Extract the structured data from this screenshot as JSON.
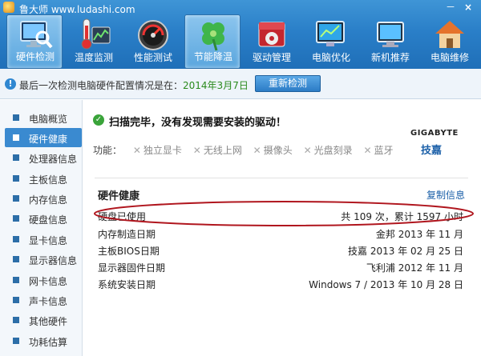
{
  "app": {
    "title": "鲁大师 www.ludashi.com",
    "minimize_label": "－",
    "close_label": "×"
  },
  "toolbar": {
    "items": [
      {
        "label": "硬件检测",
        "icon": "monitor-magnifier-icon",
        "active": true
      },
      {
        "label": "温度监测",
        "icon": "thermometer-icon",
        "active": false
      },
      {
        "label": "性能测试",
        "icon": "speedometer-icon",
        "active": false
      },
      {
        "label": "节能降温",
        "icon": "clover-leaf-icon",
        "active": true
      },
      {
        "label": "驱动管理",
        "icon": "gear-toolbox-icon",
        "active": false
      },
      {
        "label": "电脑优化",
        "icon": "optimize-screen-icon",
        "active": false
      },
      {
        "label": "新机推荐",
        "icon": "new-computer-icon",
        "active": false
      },
      {
        "label": "电脑维修",
        "icon": "repair-house-icon",
        "active": false
      }
    ]
  },
  "infobar": {
    "text": "最后一次检测电脑硬件配置情况是在：",
    "date": "2014年3月7日",
    "recheck_label": "重新检测"
  },
  "sidebar": {
    "items": [
      {
        "label": "电脑概览",
        "active": false
      },
      {
        "label": "硬件健康",
        "active": true
      },
      {
        "label": "处理器信息",
        "active": false
      },
      {
        "label": "主板信息",
        "active": false
      },
      {
        "label": "内存信息",
        "active": false
      },
      {
        "label": "硬盘信息",
        "active": false
      },
      {
        "label": "显卡信息",
        "active": false
      },
      {
        "label": "显示器信息",
        "active": false
      },
      {
        "label": "网卡信息",
        "active": false
      },
      {
        "label": "声卡信息",
        "active": false
      },
      {
        "label": "其他硬件",
        "active": false
      },
      {
        "label": "功耗估算",
        "active": false
      }
    ]
  },
  "main": {
    "scan_status": "扫描完毕，没有发现需要安装的驱动！",
    "brand": {
      "name": "GIGABYTE",
      "name_cn": "技嘉"
    },
    "features_label": "功能：",
    "features": [
      "独立显卡",
      "无线上网",
      "摄像头",
      "光盘刻录",
      "蓝牙"
    ],
    "section_title": "硬件健康",
    "copy_label": "复制信息",
    "rows": [
      {
        "label": "硬盘已使用",
        "value": "共 109 次，累计 1597 小时"
      },
      {
        "label": "内存制造日期",
        "value": "金邦 2013 年 11 月"
      },
      {
        "label": "主板BIOS日期",
        "value": "技嘉 2013 年 02 月 25 日"
      },
      {
        "label": "显示器固件日期",
        "value": "飞利浦 2012 年 11 月"
      },
      {
        "label": "系统安装日期",
        "value": "Windows 7 / 2013 年 10 月 28 日"
      }
    ]
  },
  "colors": {
    "toolbar_blue": "#2a7fc8",
    "highlight_ring": "#b0161e",
    "date_green": "#2a8a1c",
    "link_blue": "#1a5fa8"
  }
}
